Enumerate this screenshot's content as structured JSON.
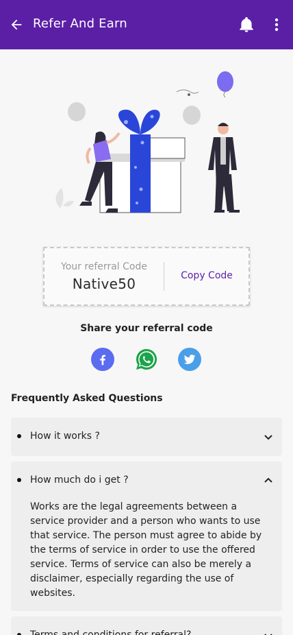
{
  "appbar": {
    "title": "Refer And Earn",
    "background": "#5b1fa6",
    "icons": [
      "arrow-back-icon",
      "bell-icon",
      "more-vert-icon"
    ]
  },
  "referral": {
    "label": "Your referral Code",
    "code": "Native50",
    "copy_label": "Copy Code"
  },
  "share": {
    "title": "Share your referral code",
    "platforms": [
      "facebook-icon",
      "whatsapp-icon",
      "twitter-icon"
    ]
  },
  "faq": {
    "title": "Frequently Asked Questions",
    "items": [
      {
        "question": "How it works ?",
        "expanded": false
      },
      {
        "question": "How much do i get ?",
        "expanded": true,
        "answer": "Works are the legal agreements between a service provider and a person who wants to use that service. The person must agree to abide by the terms of service in order to use the offered service. Terms of service can also be merely a disclaimer, especially regarding the use of websites."
      },
      {
        "question": "Terms and conditions for referral?",
        "expanded": false
      }
    ]
  },
  "colors": {
    "accent": "#5b1fa6",
    "gift": "#2a46d9",
    "balloon": "#7b6cf0"
  }
}
